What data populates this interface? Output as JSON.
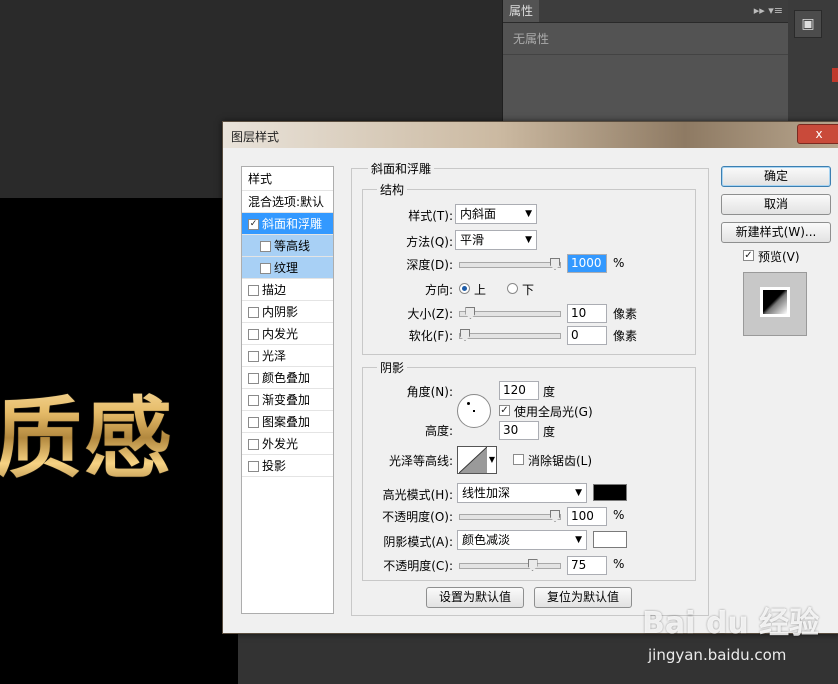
{
  "canvas": {
    "art_text": "质感"
  },
  "properties_panel": {
    "tab": "属性",
    "menu_glyph": "▸▸ ▾≡",
    "empty_text": "无属性",
    "strip_icon": "cube-icon"
  },
  "dialog": {
    "title": "图层样式",
    "close_label": "x",
    "style_list": {
      "header": "样式",
      "blend_options": "混合选项:默认",
      "items": [
        {
          "label": "斜面和浮雕",
          "checked": true,
          "selected": true
        },
        {
          "label": "等高线",
          "checked": false,
          "sub": true
        },
        {
          "label": "纹理",
          "checked": false,
          "sub": true
        },
        {
          "label": "描边",
          "checked": false
        },
        {
          "label": "内阴影",
          "checked": false
        },
        {
          "label": "内发光",
          "checked": false
        },
        {
          "label": "光泽",
          "checked": false
        },
        {
          "label": "颜色叠加",
          "checked": false
        },
        {
          "label": "渐变叠加",
          "checked": false
        },
        {
          "label": "图案叠加",
          "checked": false
        },
        {
          "label": "外发光",
          "checked": false
        },
        {
          "label": "投影",
          "checked": false
        }
      ]
    },
    "bevel": {
      "section_title": "斜面和浮雕",
      "structure": {
        "title": "结构",
        "style_label": "样式(T):",
        "style_value": "内斜面",
        "technique_label": "方法(Q):",
        "technique_value": "平滑",
        "depth_label": "深度(D):",
        "depth_value": "1000",
        "depth_unit": "%",
        "depth_fraction": 1.0,
        "direction_label": "方向:",
        "direction_up": "上",
        "direction_down": "下",
        "size_label": "大小(Z):",
        "size_value": "10",
        "size_unit": "像素",
        "size_fraction": 0.06,
        "soften_label": "软化(F):",
        "soften_value": "0",
        "soften_unit": "像素",
        "soften_fraction": 0.0
      },
      "shading": {
        "title": "阴影",
        "angle_label": "角度(N):",
        "angle_value": "120",
        "angle_unit": "度",
        "global_light_label": "使用全局光(G)",
        "altitude_label": "高度:",
        "altitude_value": "30",
        "altitude_unit": "度",
        "gloss_contour_label": "光泽等高线:",
        "anti_alias_label": "消除锯齿(L)",
        "highlight_mode_label": "高光模式(H):",
        "highlight_mode_value": "线性加深",
        "highlight_color": "#000000",
        "highlight_opacity_label": "不透明度(O):",
        "highlight_opacity_value": "100",
        "highlight_opacity_unit": "%",
        "highlight_opacity_fraction": 1.0,
        "shadow_mode_label": "阴影模式(A):",
        "shadow_mode_value": "颜色减淡",
        "shadow_color": "#ffffff",
        "shadow_opacity_label": "不透明度(C):",
        "shadow_opacity_value": "75",
        "shadow_opacity_unit": "%",
        "shadow_opacity_fraction": 0.75
      },
      "make_default": "设置为默认值",
      "reset_default": "复位为默认值"
    },
    "buttons": {
      "ok": "确定",
      "cancel": "取消",
      "new_style": "新建样式(W)...",
      "preview": "预览(V)"
    }
  },
  "watermark": {
    "logo": "Bai du 经验",
    "url": "jingyan.baidu.com"
  }
}
